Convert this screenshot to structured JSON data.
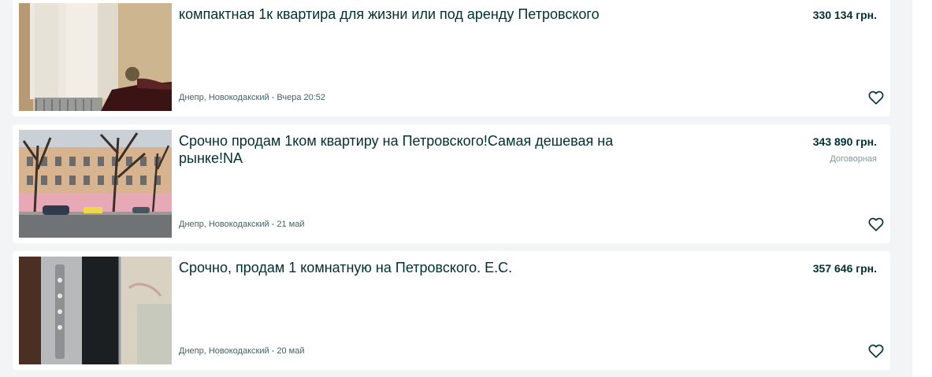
{
  "listings": [
    {
      "title": "компактная 1к квартира для жизни или под аренду Петровского",
      "price": "330 134 грн.",
      "negotiable": "",
      "location_date": "Днепр, Новокодакский - Вчера 20:52",
      "favorite_icon": "heart-outline-icon"
    },
    {
      "title": "Срочно продам 1ком квартиру на Петровского!Самая дешевая на рынке!NA",
      "price": "343 890 грн.",
      "negotiable": "Договорная",
      "location_date": "Днепр, Новокодакский - 21 май",
      "favorite_icon": "heart-outline-icon"
    },
    {
      "title": "Срочно, продам 1 комнатную на Петровского. Е.С.",
      "price": "357 646 грн.",
      "negotiable": "",
      "location_date": "Днепр, Новокодакский - 20 май",
      "favorite_icon": "heart-outline-icon"
    }
  ],
  "colors": {
    "page_background": "#f2f4f5",
    "card_background": "#ffffff",
    "text_primary": "#002f34",
    "text_secondary": "#406367",
    "text_muted": "#7f9799"
  }
}
